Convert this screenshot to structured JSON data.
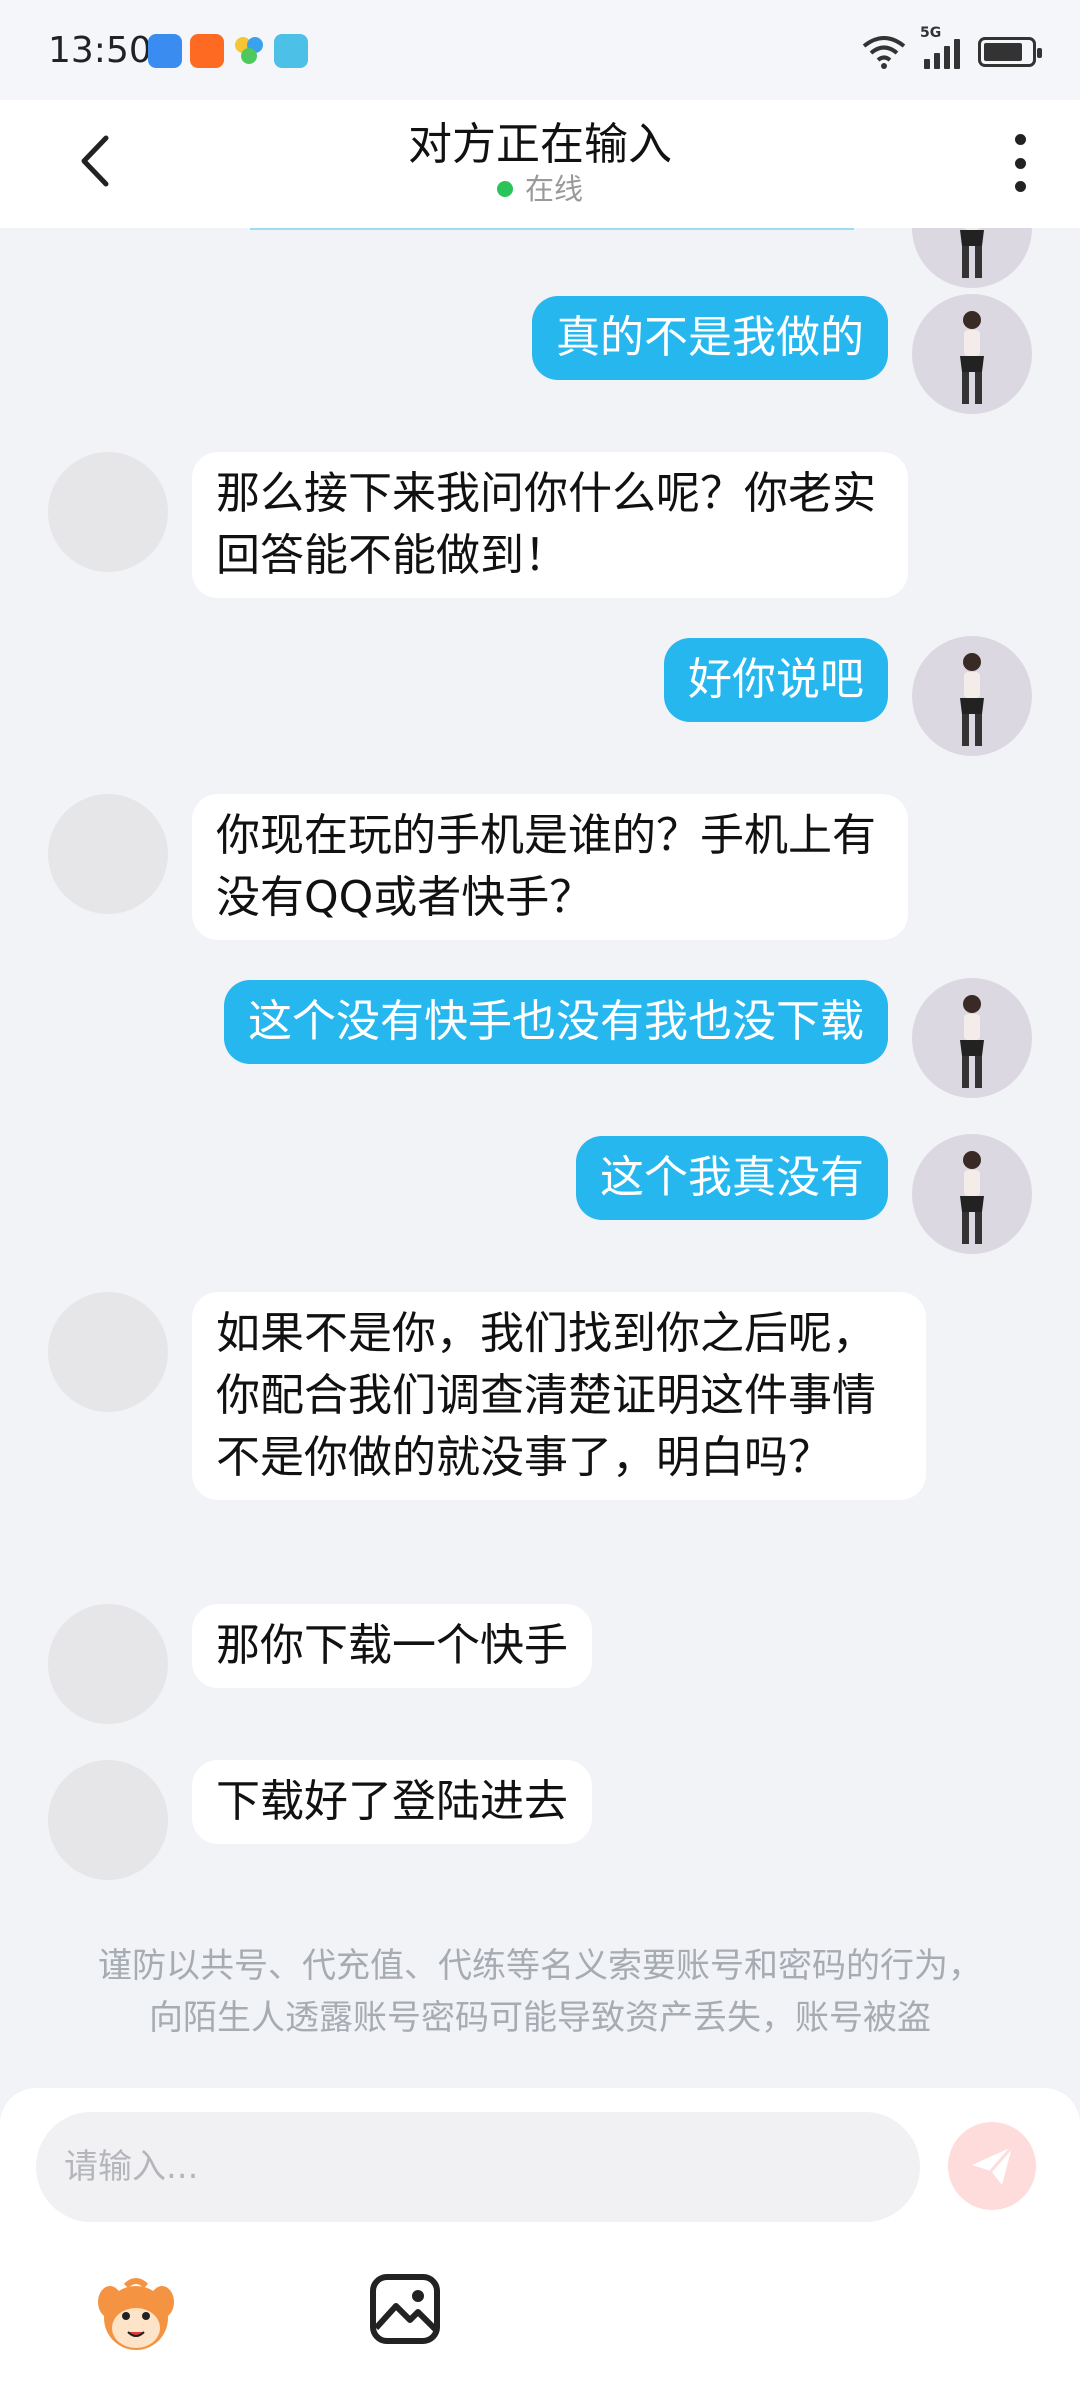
{
  "status_bar": {
    "time": "13:50",
    "network": "5G"
  },
  "header": {
    "title": "对方正在输入",
    "status": "在线"
  },
  "messages": [
    {
      "sender": "me",
      "text": "真的不是我做的"
    },
    {
      "sender": "other",
      "text": "那么接下来我问你什么呢？你老实回答能不能做到！"
    },
    {
      "sender": "me",
      "text": "好你说吧"
    },
    {
      "sender": "other",
      "text": "你现在玩的手机是谁的？手机上有没有QQ或者快手？"
    },
    {
      "sender": "me",
      "text": "这个没有快手也没有我也没下载"
    },
    {
      "sender": "me",
      "text": "这个我真没有"
    },
    {
      "sender": "other",
      "text": "如果不是你，我们找到你之后呢，你配合我们调查清楚证明这件事情不是你做的就没事了，明白吗？"
    },
    {
      "sender": "other",
      "text": "那你下载一个快手"
    },
    {
      "sender": "other",
      "text": "下载好了登陆进去"
    }
  ],
  "notice": {
    "line1": "谨防以共号、代充值、代练等名义索要账号和密码的行为，",
    "line2": "向陌生人透露账号密码可能导致资产丢失，账号被盗"
  },
  "input": {
    "placeholder": "请输入..."
  },
  "colors": {
    "my_bubble": "#26b7ef",
    "other_bubble": "#ffffff",
    "background": "#f1f3f6",
    "online_dot": "#2bc45a",
    "send_button": "#ffdcdc"
  },
  "icons": [
    "back-icon",
    "more-icon",
    "send-icon",
    "emoji-icon",
    "image-icon",
    "wifi-icon",
    "battery-icon"
  ]
}
